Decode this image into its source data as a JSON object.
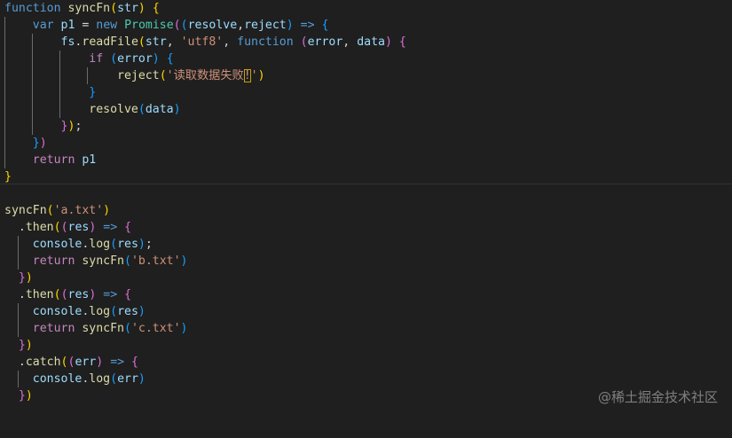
{
  "code": {
    "l1_kw_function": "function",
    "l1_fn": "syncFn",
    "l1_p1": "(",
    "l1_param": "str",
    "l1_p2": ")",
    "l1_b": "{",
    "l2_var": "var",
    "l2_name": "p1",
    "l2_eq": "=",
    "l2_new": "new",
    "l2_cls": "Promise",
    "l2_p": "(",
    "l2_pp": "(",
    "l2_resolve": "resolve",
    "l2_comma": ",",
    "l2_reject": "reject",
    "l2_ppc": ")",
    "l2_arrow": "=>",
    "l2_b": "{",
    "l3_fs": "fs",
    "l3_dot": ".",
    "l3_fn": "readFile",
    "l3_p": "(",
    "l3_str": "str",
    "l3_c1": ",",
    "l3_utf8": "'utf8'",
    "l3_c2": ",",
    "l3_function": "function",
    "l3_pp": "(",
    "l3_error": "error",
    "l3_c3": ",",
    "l3_data": "data",
    "l3_ppc": ")",
    "l3_b": "{",
    "l4_if": "if",
    "l4_p": "(",
    "l4_error": "error",
    "l4_pc": ")",
    "l4_b": "{",
    "l5_fn": "reject",
    "l5_p": "(",
    "l5_str1": "'读取数据失败",
    "l5_sel": "!",
    "l5_str2": "'",
    "l5_pc": ")",
    "l6_b": "}",
    "l7_fn": "resolve",
    "l7_p": "(",
    "l7_data": "data",
    "l7_pc": ")",
    "l8_b": "}",
    "l8_pc": ")",
    "l8_semi": ";",
    "l9_b": "}",
    "l9_pc": ")",
    "l10_return": "return",
    "l10_p1": "p1",
    "l11_b": "}",
    "l13_fn": "syncFn",
    "l13_p": "(",
    "l13_str": "'a.txt'",
    "l13_pc": ")",
    "l14_dot": ".",
    "l14_then": "then",
    "l14_p": "(",
    "l14_pp": "(",
    "l14_res": "res",
    "l14_ppc": ")",
    "l14_arrow": "=>",
    "l14_b": "{",
    "l15_console": "console",
    "l15_dot": ".",
    "l15_log": "log",
    "l15_p": "(",
    "l15_res": "res",
    "l15_pc": ")",
    "l15_semi": ";",
    "l16_return": "return",
    "l16_fn": "syncFn",
    "l16_p": "(",
    "l16_str": "'b.txt'",
    "l16_pc": ")",
    "l17_b": "}",
    "l17_pc": ")",
    "l18_dot": ".",
    "l18_then": "then",
    "l18_p": "(",
    "l18_pp": "(",
    "l18_res": "res",
    "l18_ppc": ")",
    "l18_arrow": "=>",
    "l18_b": "{",
    "l19_console": "console",
    "l19_dot": ".",
    "l19_log": "log",
    "l19_p": "(",
    "l19_res": "res",
    "l19_pc": ")",
    "l20_return": "return",
    "l20_fn": "syncFn",
    "l20_p": "(",
    "l20_str": "'c.txt'",
    "l20_pc": ")",
    "l21_b": "}",
    "l21_pc": ")",
    "l22_dot": ".",
    "l22_catch": "catch",
    "l22_p": "(",
    "l22_pp": "(",
    "l22_err": "err",
    "l22_ppc": ")",
    "l22_arrow": "=>",
    "l22_b": "{",
    "l23_console": "console",
    "l23_dot": ".",
    "l23_log": "log",
    "l23_p": "(",
    "l23_err": "err",
    "l23_pc": ")",
    "l24_b": "}",
    "l24_pc": ")"
  },
  "watermark": "@稀土掘金技术社区",
  "colors": {
    "background": "#1f1f1f",
    "keyword": "#569cd6",
    "function": "#dcdcaa",
    "variable": "#9cdcfe",
    "class": "#4ec9b0",
    "string": "#ce9178",
    "control": "#c586c0",
    "bracket_gold": "#ffd700",
    "bracket_orchid": "#da70d6",
    "bracket_blue": "#179fff"
  }
}
